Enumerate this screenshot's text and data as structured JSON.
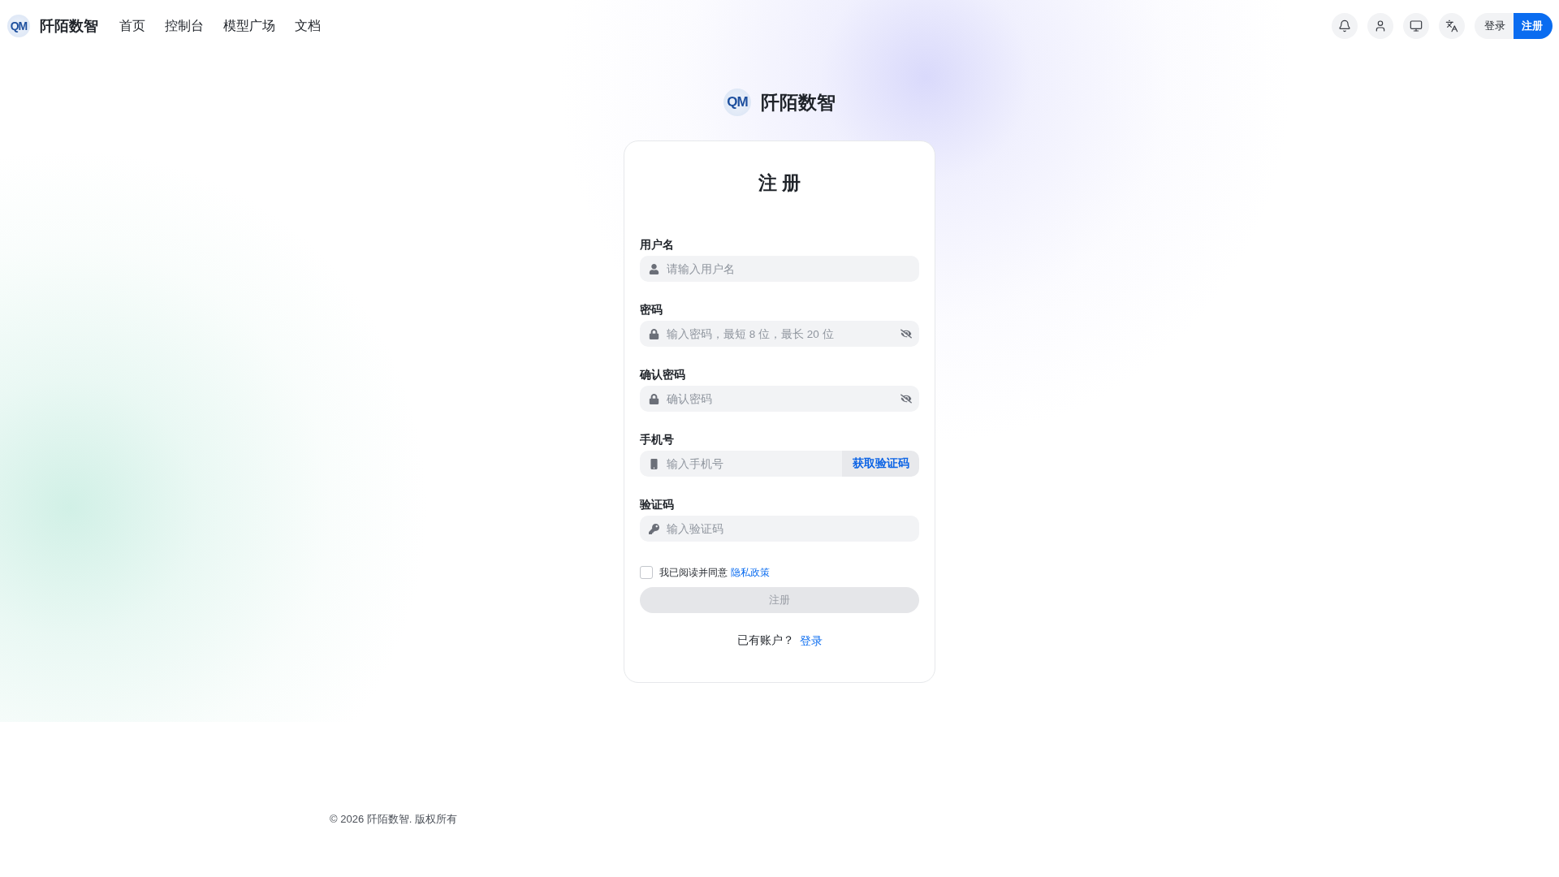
{
  "header": {
    "brand": {
      "logo_mark": "QM",
      "name": "阡陌数智"
    },
    "nav": [
      "首页",
      "控制台",
      "模型广场",
      "文档"
    ],
    "auth_buttons": [
      {
        "label": "登录",
        "kind": "secondary"
      },
      {
        "label": "注册",
        "kind": "primary"
      }
    ]
  },
  "brand": {
    "logo_mark": "QM",
    "name": "阡陌数智"
  },
  "form": {
    "title": "注 册",
    "fields": [
      {
        "label": "用户名",
        "placeholder": "请输入用户名",
        "kind": "text"
      },
      {
        "label": "密码",
        "placeholder": "输入密码，最短 8 位，最长 20 位",
        "kind": "password"
      },
      {
        "label": "确认密码",
        "placeholder": "确认密码",
        "kind": "password"
      },
      {
        "label": "手机号",
        "placeholder": "输入手机号",
        "kind": "phone",
        "action": "获取验证码"
      },
      {
        "label": "验证码",
        "placeholder": "输入验证码",
        "kind": "code"
      }
    ],
    "agreement": {
      "text": "我已阅读并同意",
      "link": "隐私政策",
      "checked": false
    },
    "submit": {
      "label": "注册",
      "disabled": true
    },
    "login_prompt": {
      "text": "已有账户？",
      "link": "登录"
    }
  },
  "footer": {
    "text": "© 2026 阡陌数智. 版权所有"
  }
}
